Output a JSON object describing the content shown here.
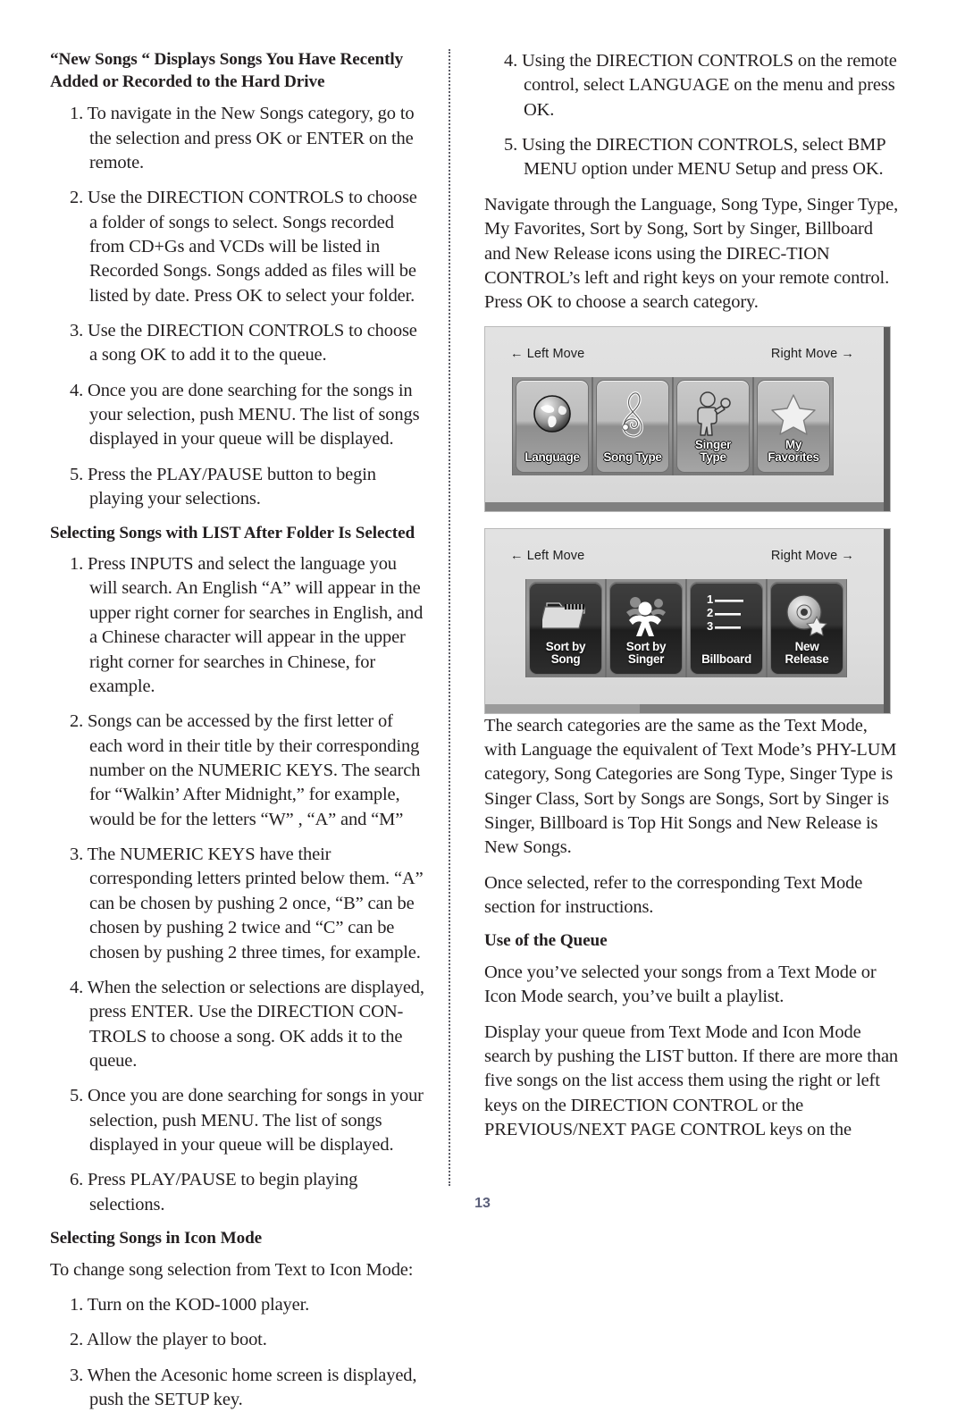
{
  "page": {
    "number": "13",
    "folio_color": "#5b5f7a"
  },
  "left_column": {
    "heading_new_songs": "“New Songs “ Displays Songs You Have Recently Added or Recorded to the Hard Drive",
    "new_songs_steps": [
      "1. To navigate in the New Songs category, go to the selection and press OK or ENTER on the remote.",
      "2. Use the DIRECTION CONTROLS to choose a folder of songs to select. Songs recorded from CD+Gs and VCDs will be listed in Recorded Songs. Songs added as files will be listed by date. Press OK to select your folder.",
      "3. Use the DIRECTION CONTROLS to choose a song OK to add it to the queue.",
      "4. Once you are done searching for the songs in your selection, push MENU. The list of songs displayed in your queue will be displayed.",
      "5. Press the PLAY/PAUSE button to begin playing your selections."
    ],
    "heading_list_after_folder": "Selecting Songs with LIST After Folder Is Selected",
    "list_steps": [
      "1. Press INPUTS and select the language you will search. An English “A” will appear in the upper right corner for searches in English, and a Chinese character will appear in the upper right corner for searches in Chinese, for example.",
      "2. Songs can be accessed by the first letter of each word in their title by their corresponding number on the NUMERIC KEYS. The search for “Walkin’ After Midnight,” for example, would be for the letters “W” , “A” and “M”",
      "3. The NUMERIC KEYS have their corresponding letters printed below them. “A” can be chosen by pushing 2 once, “B” can be chosen by pushing 2 twice and “C” can be chosen by pushing 2 three times, for example.",
      "4. When the selection or selections are displayed, press ENTER. Use the DIRECTION CON-TROLS to choose a song. OK adds it to the queue.",
      "5. Once you are done searching for songs in your selection, push MENU. The list of songs displayed in your queue will be displayed.",
      "6. Press PLAY/PAUSE to begin playing selections."
    ],
    "heading_icon_mode": "Selecting Songs in Icon Mode",
    "icon_mode_intro": "To change song selection from Text to Icon Mode:",
    "icon_mode_steps": [
      "1. Turn on the KOD-1000 player.",
      "2. Allow the player to boot.",
      "3. When the Acesonic home screen is displayed, push the SETUP key."
    ]
  },
  "right_column": {
    "continued_steps": [
      "4. Using the DIRECTION CONTROLS on the remote control, select LANGUAGE on the menu and press OK.",
      "5. Using the DIRECTION CONTROLS, select BMP MENU option under MENU Setup and press OK."
    ],
    "navigate_paragraph": "Navigate through the Language, Song Type, Singer Type, My Favorites, Sort by Song, Sort by Singer, Billboard and New Release icons using the DIREC-TION CONTROL’s left and right keys on your remote control. Press OK to choose a search category.",
    "search_categories_paragraph": "The search categories are the same as the Text Mode, with Language the equivalent of Text Mode’s PHY-LUM category, Song Categories are Song Type, Singer Type is Singer Class, Sort by Songs are Songs, Sort by Singer is Singer, Billboard is Top Hit Songs and New Release is New Songs.",
    "once_selected_paragraph": "Once selected, refer to the corresponding Text Mode section for instructions.",
    "heading_use_of_queue": "Use of the Queue",
    "queue_paragraph_1": "Once you’ve selected your songs from a Text Mode or Icon Mode search, you’ve built a playlist.",
    "queue_paragraph_2": "Display your queue from Text Mode and Icon Mode search by pushing the LIST button. If there are more than five songs on the list access them using the right or left keys on the DIRECTION CONTROL or the PREVIOUS/NEXT PAGE CONTROL keys on the"
  },
  "figures": [
    {
      "name": "icon-mode-screen-1",
      "left_move_label": "← Left Move",
      "right_move_label": "Right Move →",
      "style": "light",
      "tiles": [
        {
          "icon": "globe-icon",
          "label_line1": "Language",
          "label_line2": ""
        },
        {
          "icon": "treble-clef-icon",
          "label_line1": "Song Type",
          "label_line2": ""
        },
        {
          "icon": "singer-icon",
          "label_line1": "Singer",
          "label_line2": "Type"
        },
        {
          "icon": "star-icon",
          "label_line1": "My",
          "label_line2": "Favorites"
        }
      ]
    },
    {
      "name": "icon-mode-screen-2",
      "left_move_label": "← Left Move",
      "right_move_label": "Right Move →",
      "style": "dark",
      "tiles": [
        {
          "icon": "folder-icon",
          "label_line1": "Sort by",
          "label_line2": "Song"
        },
        {
          "icon": "person-icon",
          "label_line1": "Sort by",
          "label_line2": "Singer"
        },
        {
          "icon": "ranked-list-icon",
          "label_line1": "Billboard",
          "label_line2": ""
        },
        {
          "icon": "disc-star-icon",
          "label_line1": "New",
          "label_line2": "Release"
        }
      ]
    }
  ]
}
